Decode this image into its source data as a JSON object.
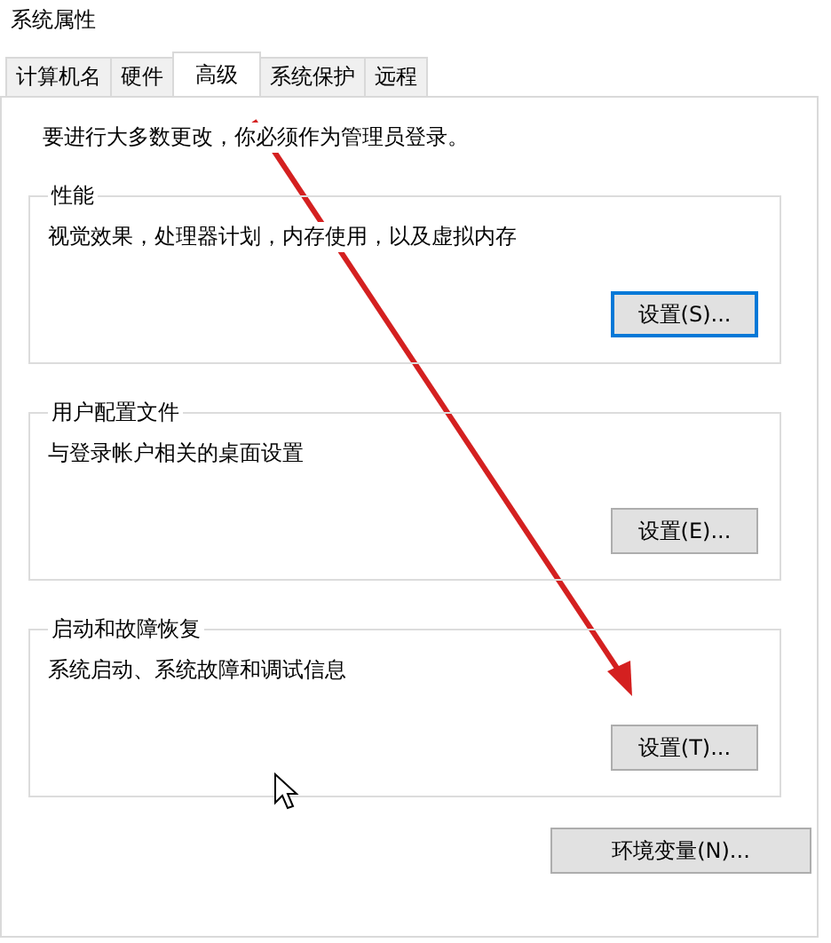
{
  "window": {
    "title": "系统属性"
  },
  "tabs": [
    {
      "label": "计算机名",
      "selected": false
    },
    {
      "label": "硬件",
      "selected": false
    },
    {
      "label": "高级",
      "selected": true
    },
    {
      "label": "系统保护",
      "selected": false
    },
    {
      "label": "远程",
      "selected": false
    }
  ],
  "admin_note": "要进行大多数更改，你必须作为管理员登录。",
  "groups": [
    {
      "title": "性能",
      "description": "视觉效果，处理器计划，内存使用，以及虚拟内存",
      "button": {
        "label": "设置(S)...",
        "focused": true
      }
    },
    {
      "title": "用户配置文件",
      "description": "与登录帐户相关的桌面设置",
      "button": {
        "label": "设置(E)...",
        "focused": false
      }
    },
    {
      "title": "启动和故障恢复",
      "description": "系统启动、系统故障和调试信息",
      "button": {
        "label": "设置(T)...",
        "focused": false
      }
    }
  ],
  "environment_button": {
    "label": "环境变量(N)..."
  }
}
